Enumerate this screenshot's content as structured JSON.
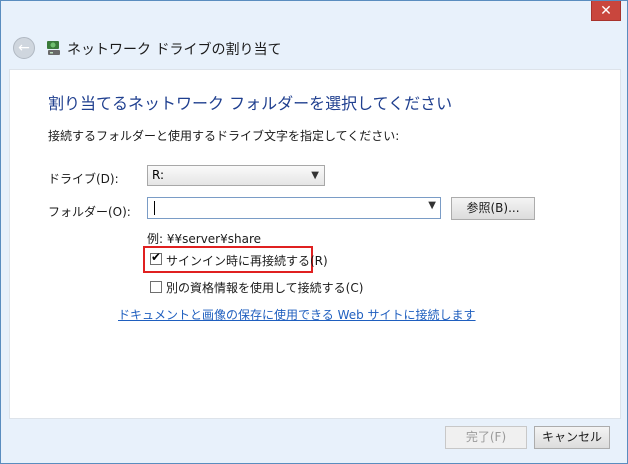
{
  "header": {
    "title": "ネットワーク ドライブの割り当て",
    "close_glyph": "✕"
  },
  "main": {
    "instruction": "割り当てるネットワーク フォルダーを選択してください",
    "description": "接続するフォルダーと使用するドライブ文字を指定してください:",
    "drive_label": "ドライブ(D):",
    "drive_value": "R:",
    "folder_label": "フォルダー(O):",
    "folder_value": "",
    "browse_label": "参照(B)...",
    "example_text": "例: ¥¥server¥share",
    "reconnect_label": "サインイン時に再接続する(R)",
    "reconnect_checked": true,
    "credentials_label": "別の資格情報を使用して接続する(C)",
    "credentials_checked": false,
    "link_text": "ドキュメントと画像の保存に使用できる Web サイトに接続します"
  },
  "footer": {
    "finish_label": "完了(F)",
    "cancel_label": "キャンセル"
  },
  "colors": {
    "accent": "#1f3f8f",
    "link": "#1f5fbf",
    "highlight": "#e02020"
  }
}
